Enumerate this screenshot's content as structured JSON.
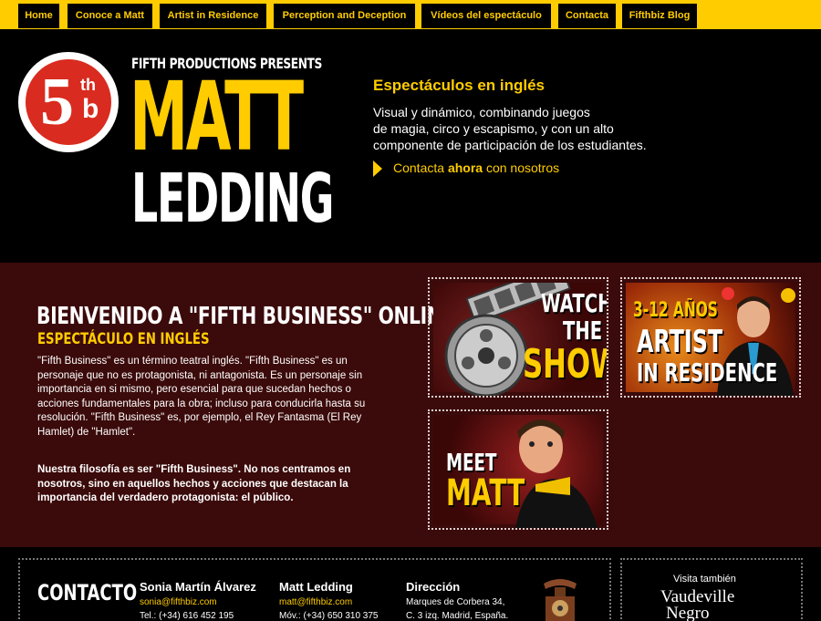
{
  "nav": {
    "items": [
      {
        "label": "Home"
      },
      {
        "label": "Conoce a Matt"
      },
      {
        "label": "Artist in Residence"
      },
      {
        "label": "Perception and Deception"
      },
      {
        "label": "Vídeos del espectáculo"
      },
      {
        "label": "Contacta"
      },
      {
        "label": "Fifthbiz Blog"
      }
    ]
  },
  "header": {
    "logo": {
      "five": "5",
      "th": "th",
      "b": "b"
    },
    "presents": "Fifth Productions Presents",
    "title_first": "MATT",
    "title_last": "LEDDING",
    "show_title": "Espectáculos en inglés",
    "show_lines": [
      "Visual y dinámico, combinando juegos",
      "de magia, circo y escapismo, y con un alto",
      "componente de participación de los estudiantes."
    ],
    "contact_prefix": "Contacta ",
    "contact_bold": "ahora",
    "contact_suffix": " con nosotros"
  },
  "main": {
    "welcome_title": "Bienvenido a \"Fifth Business\" Online",
    "welcome_sub": "Espectáculo en inglés",
    "para1": "\"Fifth Business\" es un término teatral inglés. \"Fifth Business\" es un personaje que no es protagonista, ni antagonista. Es un personaje sin importancia en si mismo, pero esencial para que sucedan hechos o acciones fundamentales para la obra; incluso para conducirla hasta su resolución. \"Fifth Business\" es, por ejemplo, el Rey Fantasma (El Rey Hamlet) de \"Hamlet\".",
    "para2": "Nuestra filosofía es ser \"Fifth Business\". No nos centramos en nosotros, sino en aquellos hechos y acciones que destacan la importancia del verdadero protagonista: el público.",
    "promos": {
      "watch": {
        "line1": "WATCH",
        "line2": "THE",
        "line3": "SHOW"
      },
      "artist": {
        "line1": "3-12 AÑOS",
        "line2": "ARTIST",
        "line3": "IN RESIDENCE"
      },
      "meet": {
        "line1": "MEET",
        "line2": "MATT"
      }
    }
  },
  "footer": {
    "heading": "CONTACTO",
    "col1": {
      "name": "Sonia Martín Álvarez",
      "email": "sonia@fifthbiz.com",
      "phone": "Tel.: (+34) 616 452 195"
    },
    "col2": {
      "name": "Matt Ledding",
      "email": "matt@fifthbiz.com",
      "phone": "Móv.: (+34) 650 310 375"
    },
    "col3": {
      "name": "Dirección",
      "line1": "Marques de Corbera 34,",
      "line2": "C. 3 izq. Madrid, España."
    },
    "visit": "Visita también",
    "vaudeville_line1": "Vaudeville",
    "vaudeville_line2": "Negro"
  },
  "colors": {
    "accent": "#ffcc00",
    "main_bg": "#3b0a0a",
    "logo_red": "#d92b1f"
  }
}
